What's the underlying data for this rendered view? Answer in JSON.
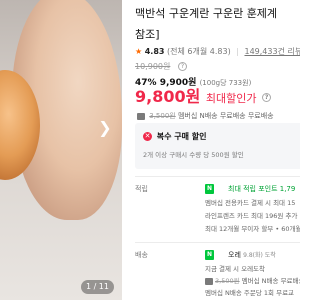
{
  "product": {
    "title_line1": "맥반석 구운계란 구운란 훈제계",
    "title_line2": "참조]",
    "rating": "4.83",
    "rating_detail": "(전체 6개월 4.83)",
    "review_count": "149,433건 리뷰"
  },
  "price": {
    "original": "10,900원",
    "discount_percent": "47%",
    "discount_price": "9,900원",
    "unit_price": "(100g당 733원)",
    "max_discount_price": "9,800원",
    "max_discount_label": "최대할인가",
    "shipping_strike": "3,500원",
    "shipping_note": "멤버십 N배송 무료배송 무료배송"
  },
  "coupon": {
    "title": "복수 구매 할인",
    "desc": "2개 이상 구매시 수량 당 500원 할인"
  },
  "points": {
    "label": "적립",
    "badge": "N",
    "headline": "최대 적립 포인트 1,79",
    "lines": [
      "멤버십 전용카드 결제 시 최대 15",
      "라인프렌즈 카드 최대 196원 추가",
      "최대 12개월 무이자 할부 • 60개월"
    ]
  },
  "delivery": {
    "label": "배송",
    "badge": "N",
    "headline": "오레",
    "headline_note": "9.8(화) 도착",
    "lines": [
      "지금 결제 시 오레도착",
      "멤버십 N배송 무료배송",
      "멤버십 N배송 주문당 1회 무료교"
    ],
    "strike": "3,500원"
  },
  "image": {
    "counter": "1 / 11",
    "icon": "chevron-right-icon"
  }
}
